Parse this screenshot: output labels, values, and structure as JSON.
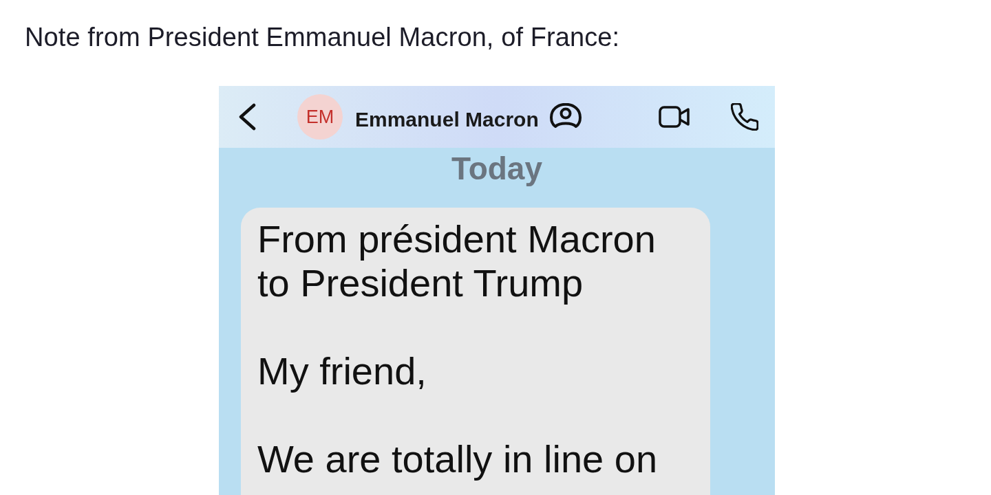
{
  "intro": {
    "text": "Note from President Emmanuel Macron, of France:"
  },
  "screenshot": {
    "header": {
      "avatar_initials": "EM",
      "contact_name": "Emmanuel Macron"
    },
    "date_label": "Today",
    "messages": [
      {
        "kind": "received",
        "paragraphs": [
          "From président Macron to President Trump",
          "My friend,",
          "We are totally in line on"
        ]
      }
    ]
  }
}
